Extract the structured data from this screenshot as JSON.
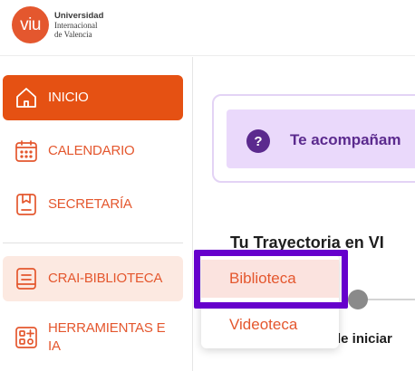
{
  "brand": {
    "logo_mark": "viu",
    "line1": "Universidad",
    "line2": "Internacional",
    "line3": "de Valencia"
  },
  "sidebar": {
    "items": [
      {
        "label": "INICIO",
        "icon": "home-icon",
        "state": "active"
      },
      {
        "label": "CALENDARIO",
        "icon": "calendar-icon",
        "state": "normal"
      },
      {
        "label": "SECRETARÍA",
        "icon": "document-icon",
        "state": "normal"
      },
      {
        "label": "CRAI-BIBLIOTECA",
        "icon": "book-icon",
        "state": "hover"
      },
      {
        "label": "HERRAMIENTAS E IA",
        "icon": "tools-icon",
        "state": "normal"
      }
    ]
  },
  "main": {
    "banner_text": "Te acompañam",
    "trajectory_title": "Tu Trayectoria en VI",
    "step_label": "le iniciar"
  },
  "dropdown": {
    "items": [
      {
        "label": "Biblioteca"
      },
      {
        "label": "Videoteca"
      }
    ]
  },
  "colors": {
    "brand_orange": "#e55113",
    "purple_accent": "#5b2a8e",
    "focus_purple": "#6600cc"
  }
}
